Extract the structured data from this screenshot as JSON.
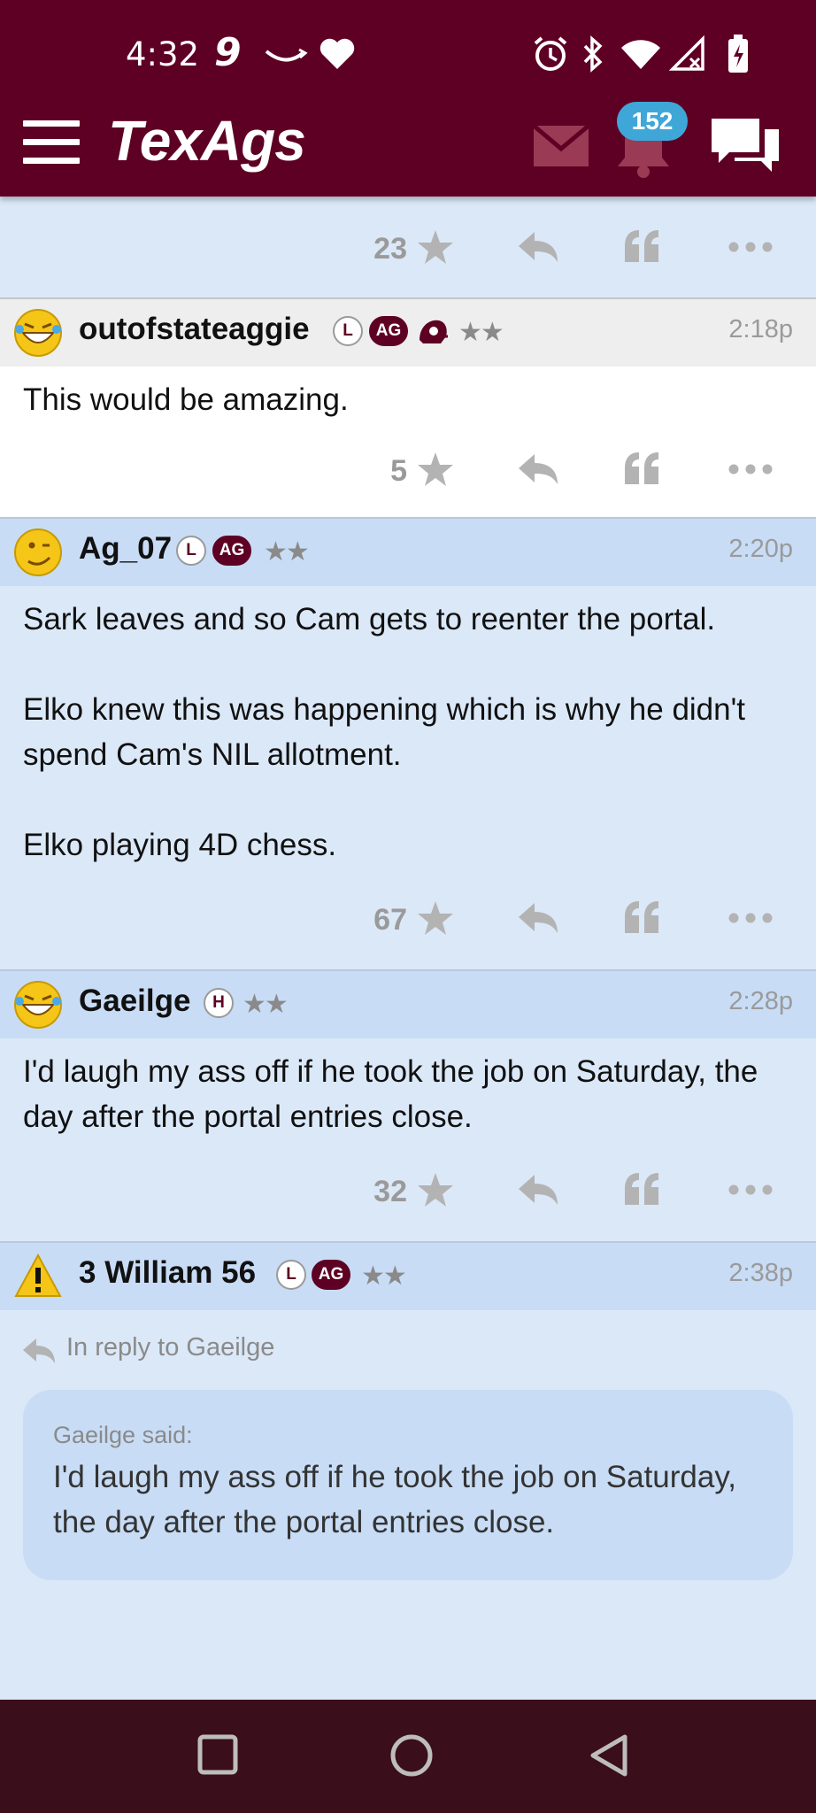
{
  "status_bar": {
    "time": "4:32",
    "carrier_glyph": "9",
    "icons": [
      "amazon-smile-icon",
      "heart-icon",
      "alarm-icon",
      "bluetooth-icon",
      "wifi-icon",
      "signal-off-icon",
      "battery-charging-icon"
    ]
  },
  "header": {
    "logo": "TexAgs",
    "notification_count": "152",
    "icons": [
      "menu-icon",
      "mail-icon",
      "bell-icon",
      "chat-icon"
    ]
  },
  "colors": {
    "brand": "#5e0023",
    "post_blue": "#dbe8f8",
    "post_head_blue": "#c8dcf5",
    "badge_blue": "#3fa7d8"
  },
  "top_actions": {
    "star_count": "23"
  },
  "posts": [
    {
      "username": "outofstateaggie",
      "badges": [
        "L",
        "AG"
      ],
      "stars": "★★",
      "time": "2:18p",
      "body": [
        "This would be amazing."
      ],
      "star_count": "5"
    },
    {
      "username": "Ag_07",
      "badges": [
        "L",
        "AG"
      ],
      "stars": "★★",
      "time": "2:20p",
      "body": [
        "Sark leaves and so Cam gets to reenter the portal.",
        "Elko knew this was happening which is why he didn't spend Cam's NIL allotment.",
        "Elko playing 4D chess."
      ],
      "star_count": "67"
    },
    {
      "username": "Gaeilge",
      "badges": [
        "H"
      ],
      "stars": "★★",
      "time": "2:28p",
      "body": [
        "I'd laugh my ass off if he took the job on Saturday, the day after the portal entries close."
      ],
      "star_count": "32"
    },
    {
      "username": "3 William 56",
      "badges": [
        "L",
        "AG"
      ],
      "stars": "★★",
      "time": "2:38p",
      "reply_to": "In reply to Gaeilge",
      "quote_author": "Gaeilge said:",
      "quote_text": "I'd laugh my ass off if he took the job on Saturday, the day after the portal entries close."
    }
  ]
}
